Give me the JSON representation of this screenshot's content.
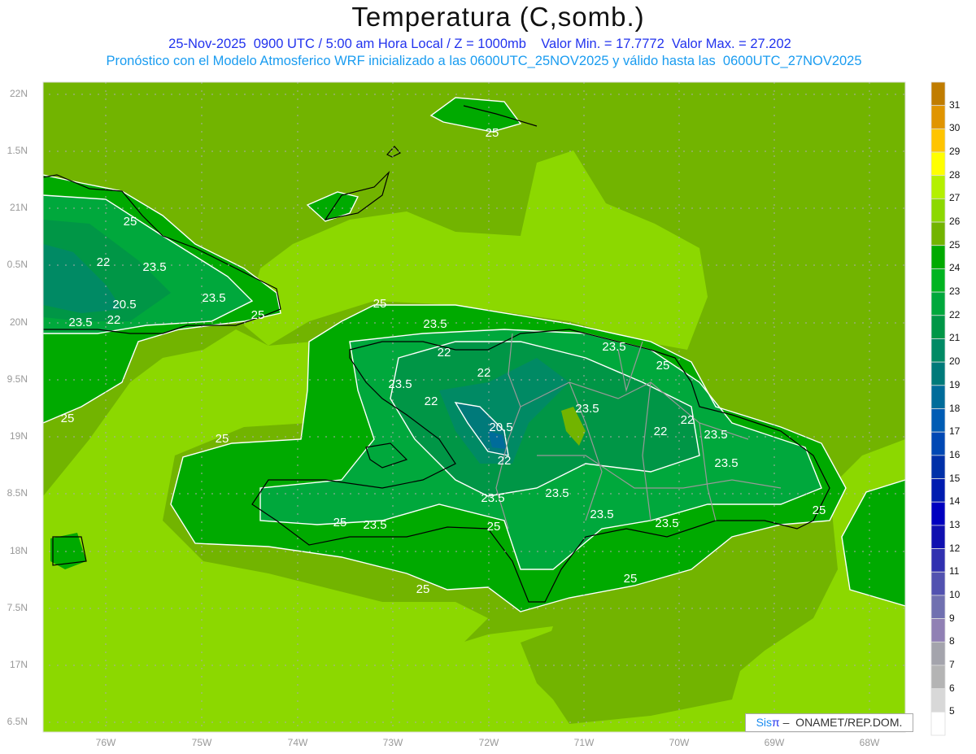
{
  "header": {
    "title": "Temperatura (C,somb.)",
    "subtitle_1": "25-Nov-2025  0900 UTC / 5:00 am Hora Local / Z = 1000mb    Valor Min. = 17.7772  Valor Max. = 27.202",
    "subtitle_2": "Pronóstico con el Modelo Atmosferico WRF inicializado a las 0600UTC_25NOV2025 y válido hasta las  0600UTC_27NOV2025"
  },
  "axes": {
    "lat_labels": [
      "22N",
      "1.5N",
      "21N",
      "0.5N",
      "20N",
      "9.5N",
      "19N",
      "8.5N",
      "18N",
      "7.5N",
      "17N",
      "6.5N"
    ],
    "lon_labels": [
      "76W",
      "75W",
      "74W",
      "73W",
      "72W",
      "71W",
      "70W",
      "69W",
      "68W"
    ]
  },
  "colorbar": {
    "labels": [
      "31",
      "30",
      "29",
      "28",
      "27",
      "26",
      "25",
      "24",
      "23",
      "22",
      "21",
      "20",
      "19",
      "18",
      "17",
      "16",
      "15",
      "14",
      "13",
      "12",
      "11",
      "10",
      "9",
      "8",
      "7",
      "6",
      "5"
    ],
    "colors": [
      "#c07c00",
      "#e09400",
      "#ffc400",
      "#ffff00",
      "#b4f000",
      "#8cd800",
      "#72b400",
      "#00aa00",
      "#00b420",
      "#00a83c",
      "#009646",
      "#008a64",
      "#007a7a",
      "#006c9a",
      "#005cb4",
      "#0048b4",
      "#0030a8",
      "#001cb0",
      "#0000c0",
      "#1010b0",
      "#3030b0",
      "#5252b0",
      "#7070b0",
      "#9080b4",
      "#a4a4ac",
      "#b4b4b4",
      "#d8d8d8",
      "#ffffff"
    ]
  },
  "contour_labels": [
    "25",
    "25",
    "22",
    "23.5",
    "23.5",
    "20.5",
    "25",
    "23.5",
    "22",
    "25",
    "25",
    "23.5",
    "22",
    "22",
    "23.5",
    "22",
    "23.5",
    "25",
    "20.5",
    "23.5",
    "22",
    "22",
    "23.5",
    "25",
    "22",
    "23.5",
    "23.5",
    "23.5",
    "23.5",
    "25",
    "23.5",
    "25",
    "23.5",
    "25",
    "25",
    "25"
  ],
  "credit": {
    "sis": "Sis",
    "pi": "π",
    "org": " –  ONAMET/REP.DOM."
  }
}
